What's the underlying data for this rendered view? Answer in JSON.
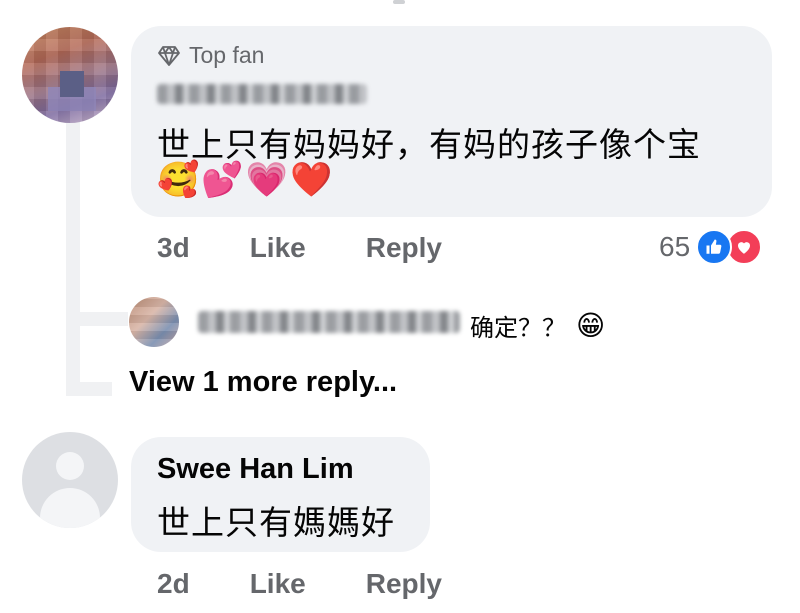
{
  "comment_main": {
    "badge": "Top fan",
    "badge_icon": "diamond-icon",
    "text": "世上只有妈妈好，有妈的孩子像个宝",
    "emojis": [
      "🥰",
      "💕",
      "💗",
      "❤️"
    ],
    "time": "3d",
    "like_label": "Like",
    "reply_label": "Reply",
    "reaction_count": "65",
    "reactions": [
      "like-icon",
      "love-icon"
    ]
  },
  "reply": {
    "text": "确定？？",
    "emoji": "😁"
  },
  "view_more": "View 1 more reply...",
  "comment_second": {
    "author": "Swee Han Lim",
    "text": "世上只有媽媽好",
    "time": "2d",
    "like_label": "Like",
    "reply_label": "Reply"
  },
  "colors": {
    "bubble": "#f0f2f5",
    "secondary_text": "#65676b",
    "like_blue": "#1877f2",
    "love_red": "#f33e58"
  }
}
